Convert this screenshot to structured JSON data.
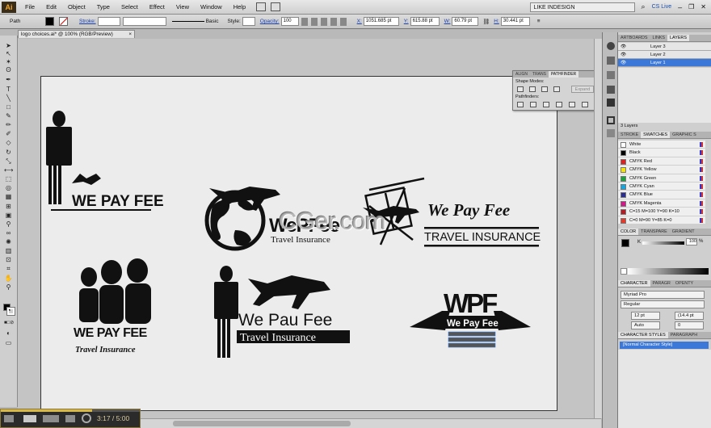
{
  "app": {
    "logo": "Ai",
    "workspace": "LIKE INDESIGN",
    "cs_live": "CS Live"
  },
  "menu": [
    "File",
    "Edit",
    "Object",
    "Type",
    "Select",
    "Effect",
    "View",
    "Window",
    "Help"
  ],
  "control": {
    "selection": "Path",
    "stroke_label": "Stroke:",
    "brush_label": "Basic",
    "style_label": "Style:",
    "opacity_label": "Opacity:",
    "opacity_value": "100",
    "x_label": "X:",
    "x_value": "1051.685 pt",
    "y_label": "Y:",
    "y_value": "615.88 pt",
    "w_label": "W:",
    "w_value": "60.79 pt",
    "h_label": "H:",
    "h_value": "30.441 pt"
  },
  "document": {
    "tab_title": "logo choices.ai* @ 100% (RGB/Preview)",
    "close": "×"
  },
  "watermark": "CGer.com",
  "logos": {
    "l1_text": "WE PAY FEE",
    "l2_title": "WePFee",
    "l2_sub": "Travel Insurance",
    "l3_title": "We Pay Fee",
    "l3_sub": "TRAVEL INSURANCE",
    "l4_title": "WE PAY FEE",
    "l4_sub": "Travel Insurance",
    "l5_title": "We Pau Fee",
    "l5_sub": "Travel Insurance",
    "l6_mono": "WPF",
    "l6_title": "We Pay Fee"
  },
  "pathfinder": {
    "tabs": [
      "ALIGN",
      "TRANS",
      "PATHFINDER"
    ],
    "shape_modes": "Shape Modes:",
    "expand": "Expand",
    "pathfinders": "Pathfinders:"
  },
  "layers_panel": {
    "tabs": [
      "ARTBOARDS",
      "LINKS",
      "LAYERS"
    ],
    "layers": [
      {
        "name": "Layer 3",
        "selected": false
      },
      {
        "name": "Layer 2",
        "selected": false
      },
      {
        "name": "Layer 1",
        "selected": true
      }
    ],
    "footer": "3 Layers"
  },
  "swatches_panel": {
    "tabs": [
      "STROKE",
      "SWATCHES",
      "GRAPHIC S"
    ],
    "items": [
      {
        "name": "White",
        "color": "#ffffff"
      },
      {
        "name": "Black",
        "color": "#000000"
      },
      {
        "name": "CMYK Red",
        "color": "#e02020"
      },
      {
        "name": "CMYK Yellow",
        "color": "#f5e400"
      },
      {
        "name": "CMYK Green",
        "color": "#18a33a"
      },
      {
        "name": "CMYK Cyan",
        "color": "#13a6e0"
      },
      {
        "name": "CMYK Blue",
        "color": "#2b2d92"
      },
      {
        "name": "CMYK Magenta",
        "color": "#d4168a"
      },
      {
        "name": "C=15 M=100 Y=90 K=10",
        "color": "#b51c24"
      },
      {
        "name": "C=0 M=90 Y=85 K=0",
        "color": "#e4392b"
      }
    ]
  },
  "color_panel": {
    "tabs": [
      "COLOR",
      "TRANSPARE",
      "GRADIENT"
    ],
    "channel": "K",
    "value": "100",
    "unit": "%"
  },
  "character_panel": {
    "tabs": [
      "CHARACTER",
      "PARAGR",
      "OPENTY"
    ],
    "font": "Myriad Pro",
    "style": "Regular",
    "size": "12 pt",
    "leading": "(14.4 pt",
    "kerning": "Auto",
    "tracking": "0"
  },
  "char_styles_panel": {
    "tabs": [
      "CHARACTER STYLES",
      "PARAGRAPH"
    ],
    "item": "[Normal Character Style]"
  },
  "video": {
    "time": "3:17 / 5:00"
  }
}
